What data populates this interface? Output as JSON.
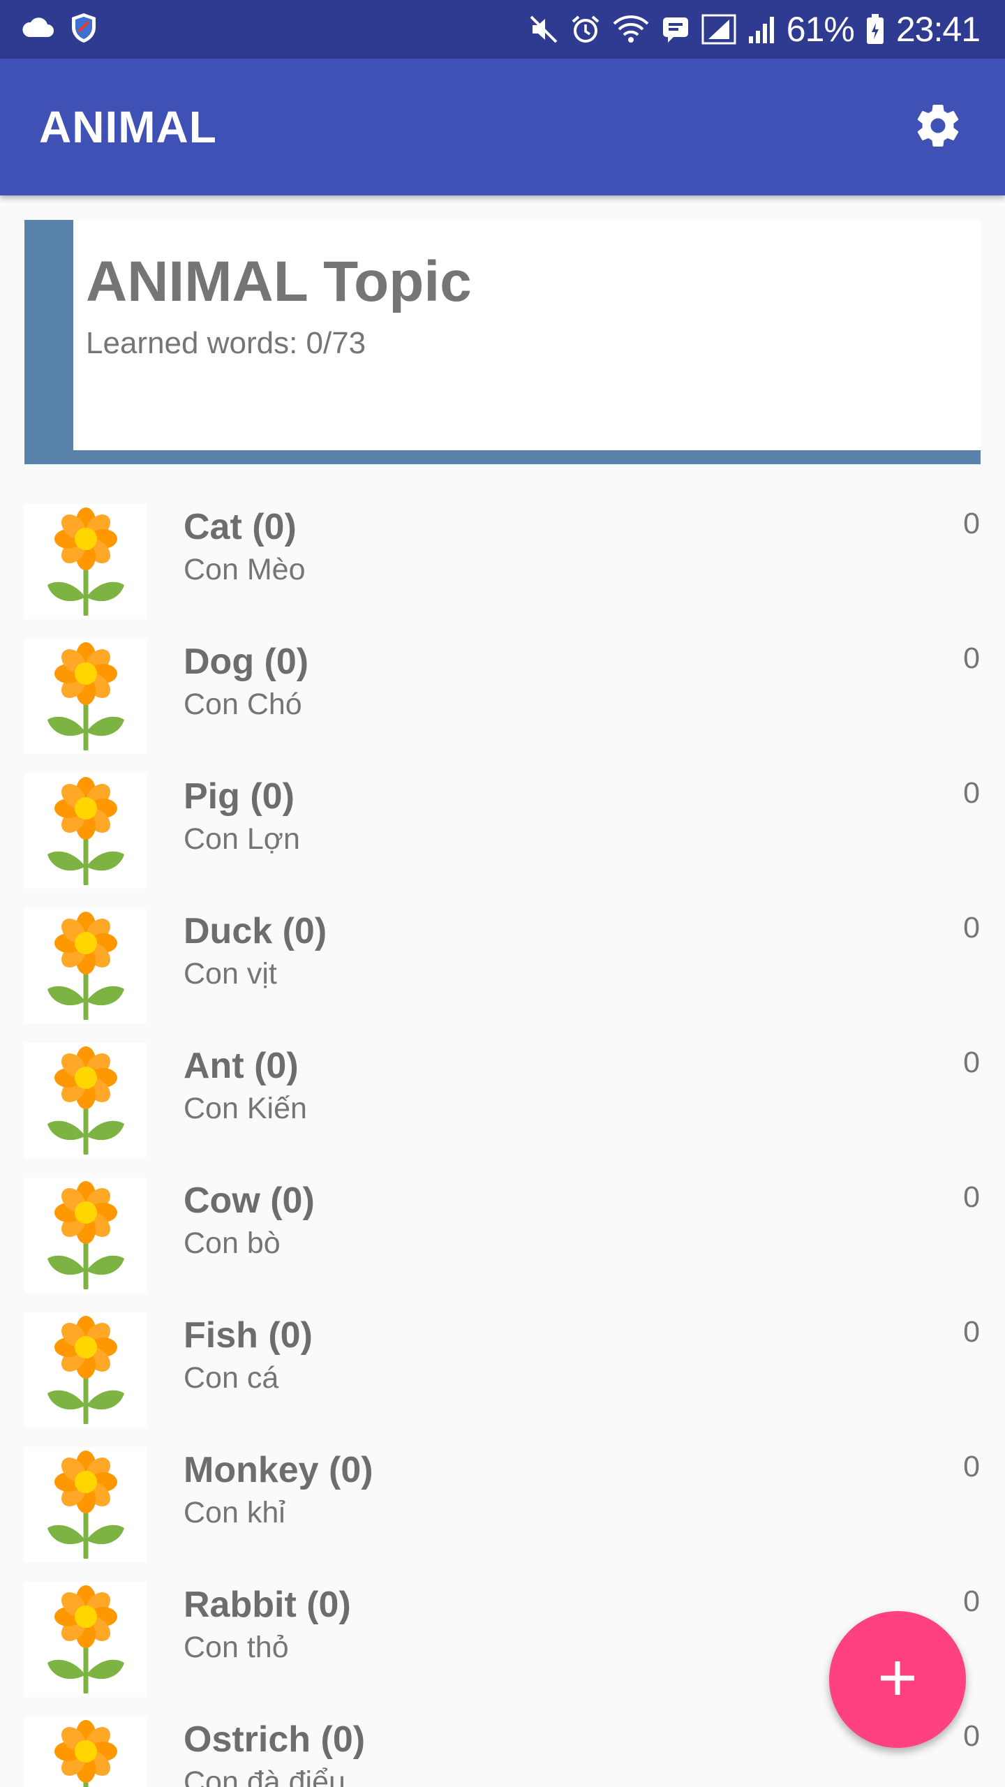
{
  "status_bar": {
    "battery": "61%",
    "time": "23:41",
    "left_icons": [
      "cloud-icon",
      "shield-icon"
    ],
    "right_icons": [
      "mute-icon",
      "alarm-icon",
      "wifi-icon",
      "message-icon",
      "signal-icon",
      "signal-icon",
      "battery-icon"
    ]
  },
  "app_bar": {
    "title": "ANIMAL",
    "settings_icon": "gear-icon"
  },
  "topic": {
    "title": "ANIMAL Topic",
    "learned": "Learned words: 0/73"
  },
  "words": [
    {
      "title": "Cat (0)",
      "meaning": "Con Mèo",
      "count": "0",
      "icon": "flower-icon"
    },
    {
      "title": "Dog (0)",
      "meaning": "Con Chó",
      "count": "0",
      "icon": "flower-icon"
    },
    {
      "title": "Pig (0)",
      "meaning": "Con Lợn",
      "count": "0",
      "icon": "flower-icon"
    },
    {
      "title": "Duck (0)",
      "meaning": "Con vịt",
      "count": "0",
      "icon": "flower-icon"
    },
    {
      "title": "Ant (0)",
      "meaning": "Con Kiến",
      "count": "0",
      "icon": "flower-icon"
    },
    {
      "title": "Cow (0)",
      "meaning": "Con bò",
      "count": "0",
      "icon": "flower-icon"
    },
    {
      "title": "Fish (0)",
      "meaning": "Con cá",
      "count": "0",
      "icon": "flower-icon"
    },
    {
      "title": "Monkey (0)",
      "meaning": "Con khỉ",
      "count": "0",
      "icon": "flower-icon"
    },
    {
      "title": "Rabbit (0)",
      "meaning": "Con thỏ",
      "count": "0",
      "icon": "flower-icon"
    },
    {
      "title": "Ostrich (0)",
      "meaning": "Con đà điểu",
      "count": "0",
      "icon": "flower-icon"
    }
  ],
  "fab": {
    "icon": "plus-icon"
  },
  "colors": {
    "status_bar": "#2f3b91",
    "app_bar": "#3f51b5",
    "topic_accent": "#5982ab",
    "fab": "#ff4081",
    "flower_petal": "#ff9800",
    "flower_center": "#ffd600",
    "flower_stem": "#7cb342"
  }
}
